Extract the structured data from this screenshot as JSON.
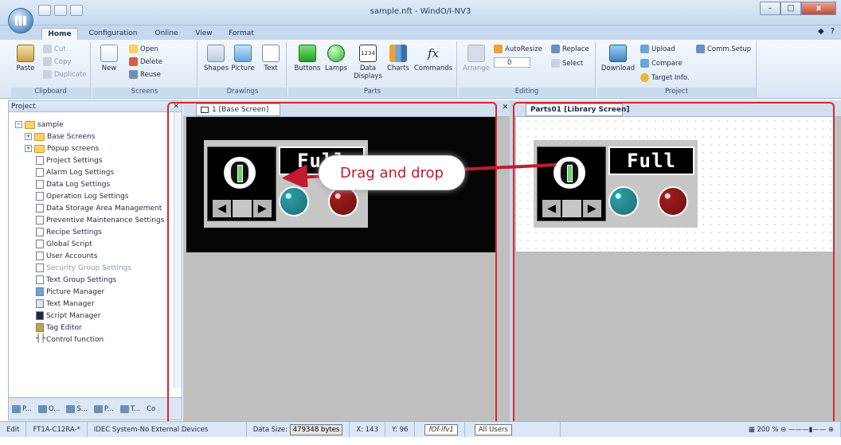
{
  "window": {
    "title": "sample.nft - WindO/I-NV3",
    "minimize": "–",
    "maximize": "□",
    "close": "x"
  },
  "tabs": [
    "Home",
    "Configuration",
    "Online",
    "View",
    "Format"
  ],
  "ribbon": {
    "clipboard": {
      "label": "Clipboard",
      "paste": "Paste",
      "cut": "Cut",
      "copy": "Copy",
      "duplicate": "Duplicate"
    },
    "screens": {
      "label": "Screens",
      "new": "New",
      "open": "Open",
      "delete": "Delete",
      "reuse": "Reuse"
    },
    "drawings": {
      "label": "Drawings",
      "shapes": "Shapes",
      "picture": "Picture",
      "text": "Text"
    },
    "parts": {
      "label": "Parts",
      "buttons": "Buttons",
      "lamps": "Lamps",
      "data_displays": "Data Displays",
      "charts": "Charts",
      "commands": "Commands",
      "data_icon": "1234",
      "fx": "fx"
    },
    "editing": {
      "label": "Editing",
      "arrange": "Arrange",
      "autoresize": "AutoResize",
      "replace": "Replace",
      "select": "Select",
      "value": "0"
    },
    "project": {
      "label": "Project",
      "download": "Download",
      "upload": "Upload",
      "compare": "Compare",
      "target_info": "Target Info.",
      "comm_setup": "Comm.Setup"
    }
  },
  "project_pane": {
    "title": "Project",
    "tree": [
      {
        "label": "sample"
      },
      {
        "label": "Base Screens"
      },
      {
        "label": "Popup screens"
      },
      {
        "label": "Project Settings"
      },
      {
        "label": "Alarm Log Settings"
      },
      {
        "label": "Data Log Settings"
      },
      {
        "label": "Operation Log Settings"
      },
      {
        "label": "Data Storage Area Management"
      },
      {
        "label": "Preventive Maintenance Settings"
      },
      {
        "label": "Recipe Settings"
      },
      {
        "label": "Global Script"
      },
      {
        "label": "User Accounts"
      },
      {
        "label": "Security Group Settings"
      },
      {
        "label": "Text Group Settings"
      },
      {
        "label": "Picture Manager"
      },
      {
        "label": "Text Manager"
      },
      {
        "label": "Script Manager"
      },
      {
        "label": "Tag Editor"
      },
      {
        "label": "Control function"
      }
    ],
    "footer": [
      "P...",
      "O...",
      "S...",
      "P...",
      "T...",
      "Co"
    ]
  },
  "editor_left": {
    "tab": "1  [Base Screen]"
  },
  "editor_right": {
    "tab": "Parts01 [Library Screen]"
  },
  "part": {
    "lcd_text": "Full"
  },
  "callout": "Drag and drop",
  "status": {
    "mode": "Edit",
    "model": "FT1A-C12RA-*",
    "device": "IDEC System-No External Devices",
    "data_size_label": "Data Size:",
    "data_size_value": "479348 bytes",
    "x": "X: 143",
    "y": "Y: 96",
    "font": "fOf-lfv1",
    "users": "All Users",
    "zoom": "200 %"
  },
  "colors": {
    "accent": "#d8262e",
    "callout_text": "#c21a2e"
  }
}
